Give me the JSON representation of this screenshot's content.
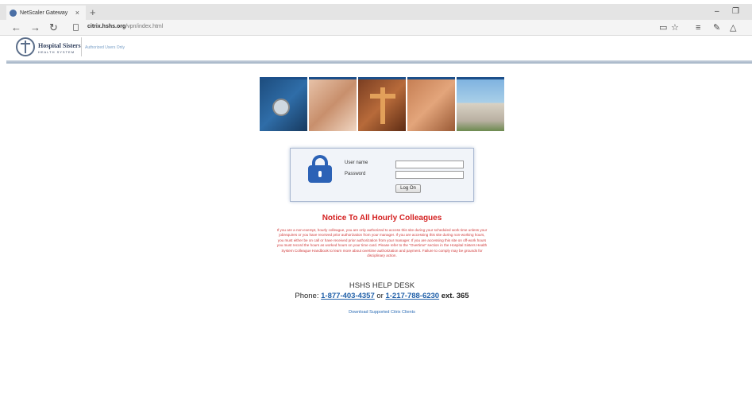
{
  "top_link": "",
  "browser": {
    "tab_title": "NetScaler Gateway",
    "tab_close": "×",
    "new_tab": "+",
    "url_host": "citrix.hshs.org",
    "url_path": "/vpn/index.html",
    "back": "←",
    "forward": "→",
    "refresh": "↻",
    "more": "···"
  },
  "header": {
    "logo_name": "Hospital Sisters",
    "logo_sub": "HEALTH SYSTEM",
    "auth_text": "Authorized Users Only"
  },
  "login": {
    "username_label": "User name",
    "password_label": "Password",
    "logon_button": "Log On"
  },
  "notice": {
    "title": "Notice To All Hourly Colleagues",
    "body": "If you are a non-exempt, hourly colleague, you are only authorized to access this site during your scheduled work time unless your jobrequires or you have received prior authorization from your manager. If you are accessing this site during non-working hours, you must either be on call or have received prior authorization from your manager. If you are accessing this site on off-work hours you must record the hours as worked hours on your time card. Please refer to the \"Overtime\" section in the Hospital Sisters Health System Colleague Handbook to learn more about overtime authorization and payment. Failure to comply may be grounds for disciplinary action."
  },
  "help": {
    "title": "HSHS HELP DESK",
    "phone_label": "Phone:",
    "phone1": "1-877-403-4357",
    "or": "or",
    "phone2": "1-217-788-6230",
    "ext": "ext. 365"
  },
  "download_link": "Download Supported Citrix Clients"
}
